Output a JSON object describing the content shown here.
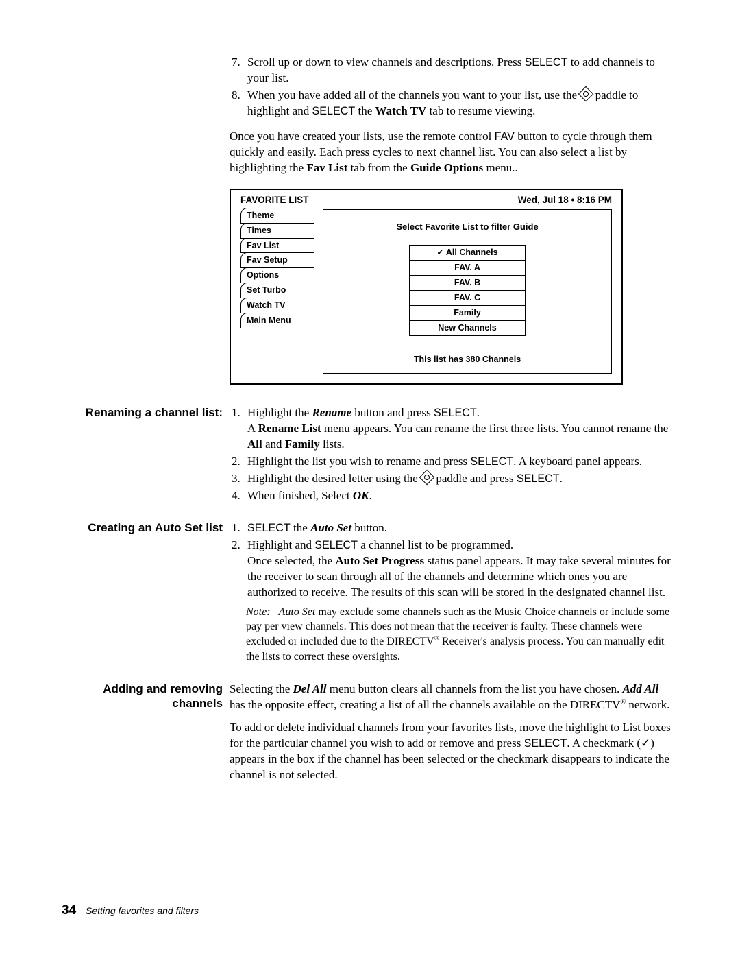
{
  "top_steps_start": 7,
  "top_steps": [
    {
      "pre": "Scroll up or down to view channels and descriptions. Press ",
      "sans": "SELECT",
      "post": " to add channels to your list."
    },
    {
      "text_html": "When you have added all of the channels you want to your list, use the {PADDLE} paddle to highlight and ",
      "sans": "SELECT",
      "post_html": " the <b>Watch TV</b> tab to resume viewing."
    }
  ],
  "intro_para_html": "Once you have created your lists, use the remote control <span class='sans'>FAV</span> button to cycle through them quickly and easily. Each press cycles to next channel list. You can also select a list by highlighting the <b>Fav List</b> tab from the <b>Guide Options</b> menu..",
  "figure": {
    "title": "FAVORITE LIST",
    "datetime": "Wed, Jul 18  •  8:16 PM",
    "tabs": [
      "Theme",
      "Times",
      "Fav List",
      "Fav Setup",
      "Options",
      "Set Turbo",
      "Watch TV",
      "Main Menu"
    ],
    "panel_title": "Select Favorite List to filter Guide",
    "options": [
      {
        "check": true,
        "label": "All Channels"
      },
      {
        "check": false,
        "label": "FAV. A"
      },
      {
        "check": false,
        "label": "FAV. B"
      },
      {
        "check": false,
        "label": "FAV. C"
      },
      {
        "check": false,
        "label": "Family"
      },
      {
        "check": false,
        "label": "New Channels"
      }
    ],
    "summary": "This list  has 380 Channels"
  },
  "sections": {
    "rename": {
      "label": "Renaming a channel list:",
      "items": [
        {
          "html": "Highlight the <b><i>Rename</i></b> button and press <span class='sans'>SELECT</span>.<br>A <b>Rename List</b> menu appears. You can rename the first three lists. You cannot rename the <b>All</b> and <b>Family</b> lists."
        },
        {
          "html": "Highlight the list you wish to rename and press <span class='sans'>SELECT</span>. A keyboard panel appears."
        },
        {
          "html": "Highlight the desired letter using the {PADDLE} paddle and press <span class='sans'>SELECT</span>."
        },
        {
          "html": "When finished, Select <b><i>OK</i></b>."
        }
      ]
    },
    "autoset": {
      "label": "Creating an Auto Set list",
      "items": [
        {
          "html": "<span class='sans'>SELECT</span> the <b><i>Auto Set</i></b> button."
        },
        {
          "html": "Highlight and <span class='sans'>SELECT</span> a channel list to be programmed.<br>Once selected, the <b>Auto Set Progress</b> status panel appears. It may take several minutes for the receiver to scan through all of the channels and determine which ones you are authorized to receive. The results of this scan will be stored in the designated channel list."
        }
      ],
      "note_html": "<i>Note:&nbsp;&nbsp;&nbsp;Auto Set</i> may exclude some channels such as the Music Choice channels or include some pay per view channels. This does not mean that the receiver is faulty. These channels were excluded or included due to the DIRECTV<span class='sup'>®</span> Receiver's analysis process. You can manually edit the lists to correct these oversights."
    },
    "addremove": {
      "label": "Adding and removing channels",
      "para1_html": "Selecting the <b><i>Del All</i></b> menu button clears all channels from the list you have chosen. <b><i>Add All</i></b> has the opposite effect, creating a list of all the channels available on the DIRECTV<span class='sup'>®</span> network.",
      "para2_html": "To add or delete individual channels from your favorites lists, move the highlight to List boxes for the particular channel you wish to add or remove and press <span class='sans'>SELECT</span>. A checkmark (✓) appears in the box if the channel has been selected or the checkmark disappears to indicate the channel is not selected."
    }
  },
  "footer": {
    "page": "34",
    "title": "Setting favorites and filters"
  }
}
